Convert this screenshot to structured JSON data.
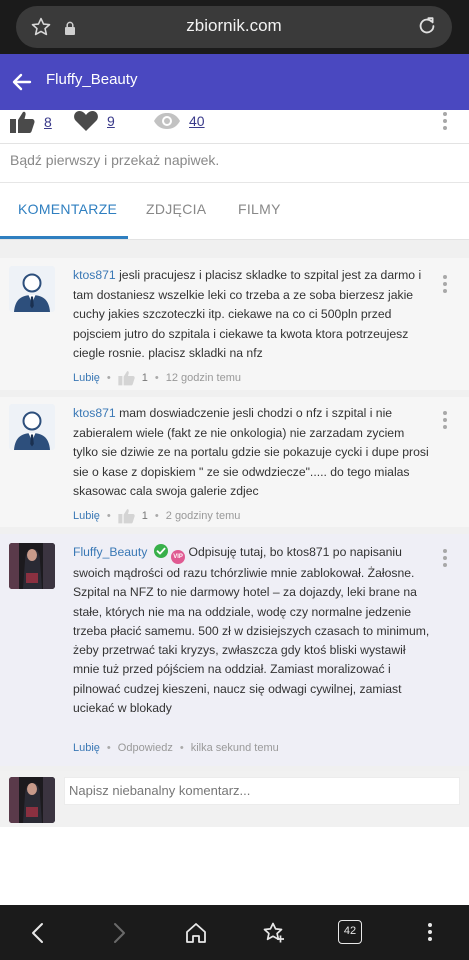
{
  "browser": {
    "url": "zbiornik.com",
    "tabs_count": "42"
  },
  "header": {
    "title": "Fluffy_Beauty"
  },
  "stats": {
    "likes": "8",
    "hearts": "9",
    "views": "40"
  },
  "tip": {
    "text": "Bądź pierwszy i przekaż napiwek."
  },
  "tabs": [
    {
      "label": "KOMENTARZE"
    },
    {
      "label": "ZDJĘCIA"
    },
    {
      "label": "FILMY"
    }
  ],
  "comments": [
    {
      "author": "ktos871",
      "text": "jesli pracujesz i placisz skladke to szpital jest za darmo i tam dostaniesz wszelkie leki co trzeba a ze soba bierzesz jakie cuchy jakies szczoteczki itp. ciekawe na co ci 500pln przed pojsciem jutro do szpitala i ciekawe ta kwota ktora potrzeujesz ciegle rosnie. placisz skladki na nfz",
      "like_label": "Lubię",
      "like_count": "1",
      "time": "12 godzin temu"
    },
    {
      "author": "ktos871",
      "text": "mam doswiadczenie jesli chodzi o nfz i szpital i nie zabieralem wiele (fakt ze nie onkologia) nie zarzadam zyciem tylko sie dziwie ze na portalu gdzie sie pokazuje cycki i dupe prosi sie o kase z dopiskiem \" ze sie odwdziecze\"..... do tego mialas skasowac cala swoja galerie zdjec",
      "like_label": "Lubię",
      "like_count": "1",
      "time": "2 godziny temu"
    },
    {
      "author": "Fluffy_Beauty",
      "vip_label": "VIP",
      "text": "Odpisuję tutaj, bo ktos871 po napisaniu swoich mądrości od razu tchórzliwie mnie zablokował. Żałosne. Szpital na NFZ to nie darmowy hotel – za dojazdy, leki brane na stałe, których nie ma na oddziale, wodę czy normalne jedzenie trzeba płacić samemu. 500 zł w dzisiejszych czasach to minimum, żeby przetrwać taki kryzys, zwłaszcza gdy ktoś bliski wystawił mnie tuż przed pójściem na oddział. Zamiast moralizować i pilnować cudzej kieszeni, naucz się odwagi cywilnej, zamiast uciekać w blokady",
      "like_label": "Lubię",
      "reply_label": "Odpowiedz",
      "time": "kilka sekund temu"
    }
  ],
  "compose": {
    "placeholder": "Napisz niebanalny komentarz..."
  },
  "colors": {
    "header": "#4a48c0",
    "accent": "#2f7fc0",
    "link": "#3a78b5"
  }
}
